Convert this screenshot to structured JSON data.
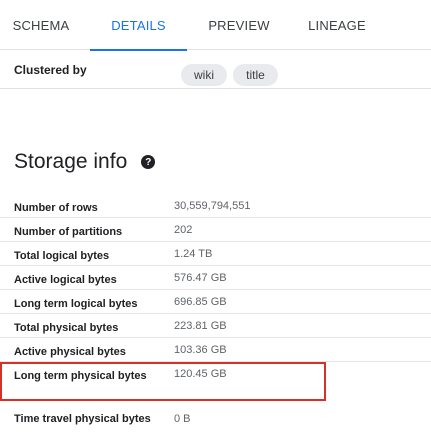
{
  "tabs": [
    {
      "label": "SCHEMA"
    },
    {
      "label": "DETAILS",
      "active": true
    },
    {
      "label": "PREVIEW"
    },
    {
      "label": "LINEAGE"
    }
  ],
  "clustered_by": {
    "label": "Clustered by",
    "chips": [
      "wiki",
      "title"
    ]
  },
  "storage_info": {
    "title": "Storage info",
    "help_icon": "help-icon",
    "rows": [
      {
        "key": "Number of rows",
        "value": "30,559,794,551"
      },
      {
        "key": "Number of partitions",
        "value": "202"
      },
      {
        "key": "Total logical bytes",
        "value": "1.24 TB"
      },
      {
        "key": "Active logical bytes",
        "value": "576.47 GB"
      },
      {
        "key": "Long term logical bytes",
        "value": "696.85 GB"
      },
      {
        "key": "Total physical bytes",
        "value": "223.81 GB"
      },
      {
        "key": "Active physical bytes",
        "value": "103.36 GB"
      },
      {
        "key": "Long term physical bytes",
        "value": "120.45 GB"
      },
      {
        "key": "Time travel physical bytes",
        "value": "0 B"
      }
    ]
  },
  "colors": {
    "accent": "#1a73e8",
    "highlight_border": "#d93025"
  }
}
